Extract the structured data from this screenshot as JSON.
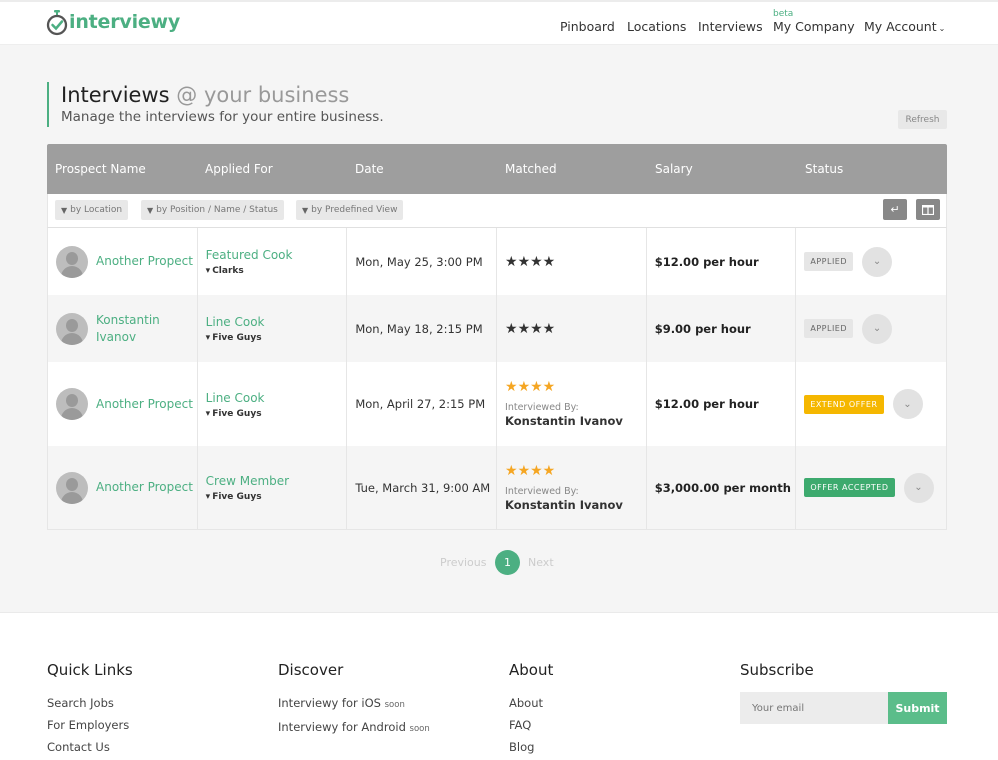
{
  "brand": {
    "name": "interviewy",
    "accent": "#4caf82"
  },
  "nav": {
    "items": [
      "Pinboard",
      "Locations",
      "Interviews",
      "My Company",
      "My Account"
    ],
    "beta_label": "beta"
  },
  "page": {
    "title": "Interviews",
    "title_suffix": "@ your business",
    "subtitle": "Manage the interviews for your entire business.",
    "refresh_label": "Refresh"
  },
  "table": {
    "columns": [
      "Prospect Name",
      "Applied For",
      "Date",
      "Matched",
      "Salary",
      "Status"
    ],
    "filters": [
      "by Location",
      "by Position / Name / Status",
      "by Predefined View"
    ],
    "rows": [
      {
        "name": "Another Propect",
        "position": "Featured Cook",
        "company": "Clarks",
        "date": "Mon, May 25, 3:00 PM",
        "stars": "★★★★",
        "star_color": "dark",
        "interviewed_by_label": "",
        "interviewer": "",
        "salary": "$12.00 per hour",
        "status": "APPLIED",
        "status_style": "gray"
      },
      {
        "name": "Konstantin Ivanov",
        "position": "Line Cook",
        "company": "Five Guys",
        "date": "Mon, May 18, 2:15 PM",
        "stars": "★★★★",
        "star_color": "dark",
        "interviewed_by_label": "",
        "interviewer": "",
        "salary": "$9.00 per hour",
        "status": "APPLIED",
        "status_style": "gray"
      },
      {
        "name": "Another Propect",
        "position": "Line Cook",
        "company": "Five Guys",
        "date": "Mon, April 27, 2:15 PM",
        "stars": "★★★★",
        "star_color": "orange",
        "interviewed_by_label": "Interviewed By:",
        "interviewer": "Konstantin Ivanov",
        "salary": "$12.00 per hour",
        "status": "EXTEND OFFER",
        "status_style": "yellow"
      },
      {
        "name": "Another Propect",
        "position": "Crew Member",
        "company": "Five Guys",
        "date": "Tue, March 31, 9:00 AM",
        "stars": "★★★★",
        "star_color": "orange",
        "interviewed_by_label": "Interviewed By:",
        "interviewer": "Konstantin Ivanov",
        "salary": "$3,000.00 per month",
        "status": "OFFER ACCEPTED",
        "status_style": "green"
      }
    ]
  },
  "pagination": {
    "previous": "Previous",
    "current": "1",
    "next": "Next"
  },
  "footer": {
    "quick_links": {
      "title": "Quick Links",
      "links": [
        "Search Jobs",
        "For Employers",
        "Contact Us"
      ]
    },
    "discover": {
      "title": "Discover",
      "links": [
        {
          "text": "Interviewy for iOS",
          "tag": "soon"
        },
        {
          "text": "Interviewy for Android",
          "tag": "soon"
        }
      ]
    },
    "about": {
      "title": "About",
      "links": [
        "About",
        "FAQ",
        "Blog"
      ]
    },
    "subscribe": {
      "title": "Subscribe",
      "placeholder": "Your email",
      "button": "Submit"
    }
  }
}
